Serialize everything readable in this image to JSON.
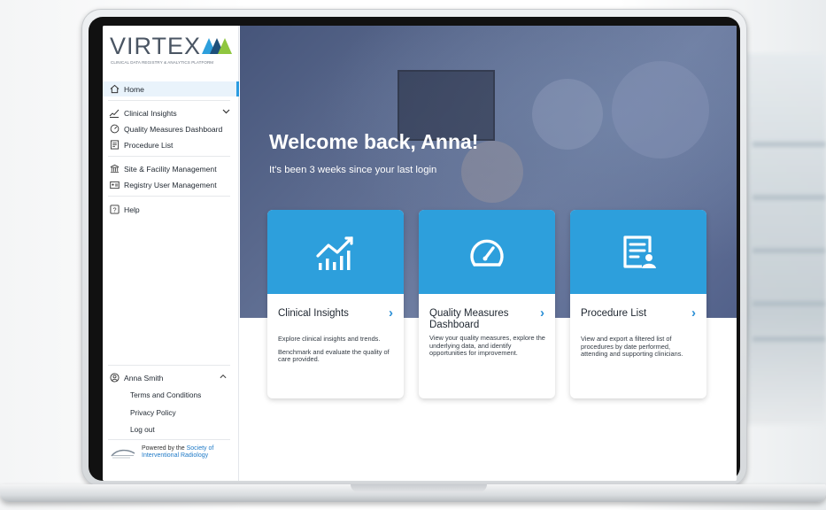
{
  "app": {
    "logo_word": "VIRTEX",
    "logo_tagline": "CLINICAL DATA REGISTRY & ANALYTICS PLATFORM"
  },
  "sidebar": {
    "items": [
      {
        "label": "Home",
        "icon": "home-icon",
        "active": true
      },
      {
        "label": "Clinical Insights",
        "icon": "chart-icon",
        "expandable": true
      },
      {
        "label": "Quality Measures Dashboard",
        "icon": "gauge-icon"
      },
      {
        "label": "Procedure List",
        "icon": "list-icon"
      },
      {
        "label": "Site & Facility Management",
        "icon": "building-icon"
      },
      {
        "label": "Registry User Management",
        "icon": "id-card-icon"
      },
      {
        "label": "Help",
        "icon": "help-icon"
      }
    ],
    "user": {
      "name": "Anna Smith",
      "links": [
        "Terms and Conditions",
        "Privacy Policy",
        "Log out"
      ]
    },
    "powered_by": {
      "prefix": "Powered by the ",
      "org_line1": "Society of",
      "org_line2": "Interventional Radiology"
    }
  },
  "hero": {
    "title": "Welcome back, Anna!",
    "subtitle": "It's been 3 weeks since your last login"
  },
  "cards": [
    {
      "title": "Clinical Insights",
      "icon": "chart-icon",
      "description": "Explore clinical insights and trends.",
      "description2": "Benchmark and evaluate the quality of care provided."
    },
    {
      "title": "Quality Measures Dashboard",
      "icon": "gauge-icon",
      "description": "View your quality measures, explore the underlying data, and identify opportunities for improvement."
    },
    {
      "title": "Procedure List",
      "icon": "document-user-icon",
      "description": "View and export a filtered list of procedures by date performed, attending and supporting clinicians."
    }
  ],
  "colors": {
    "accent": "#2d9fdc",
    "hero_tint": "#4f5e86",
    "active_nav_bg": "#e9f3fb"
  }
}
